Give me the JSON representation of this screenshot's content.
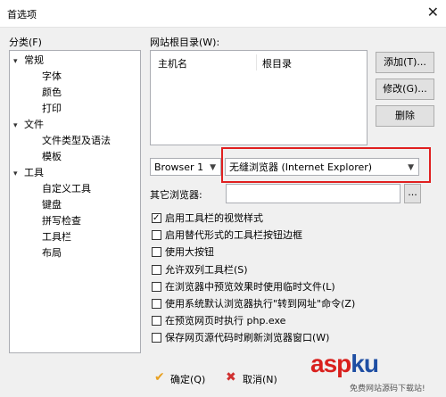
{
  "window": {
    "title": "首选项",
    "close_glyph": "✕"
  },
  "tree": {
    "label": "分类(F)",
    "nodes": [
      {
        "text": "常规",
        "level": 0,
        "expanded": true,
        "selected": false
      },
      {
        "text": "字体",
        "level": 1,
        "selected": false
      },
      {
        "text": "颜色",
        "level": 1,
        "selected": false
      },
      {
        "text": "打印",
        "level": 1,
        "selected": false
      },
      {
        "text": "文件",
        "level": 0,
        "expanded": true,
        "selected": false
      },
      {
        "text": "文件类型及语法",
        "level": 1,
        "selected": false
      },
      {
        "text": "模板",
        "level": 1,
        "selected": false
      },
      {
        "text": "工具",
        "level": 0,
        "expanded": true,
        "selected": true
      },
      {
        "text": "自定义工具",
        "level": 1,
        "selected": false
      },
      {
        "text": "键盘",
        "level": 1,
        "selected": false
      },
      {
        "text": "拼写检查",
        "level": 1,
        "selected": false
      },
      {
        "text": "工具栏",
        "level": 1,
        "selected": false
      },
      {
        "text": "布局",
        "level": 1,
        "selected": false
      }
    ]
  },
  "web_root": {
    "label": "网站根目录(W):",
    "columns": [
      "主机名",
      "根目录"
    ],
    "add": "添加(T)...",
    "edit": "修改(G)...",
    "delete": "删除"
  },
  "browser": {
    "slot_value": "Browser 1",
    "browser_value": "无缝浏览器 (Internet Explorer)",
    "other_label": "其它浏览器:",
    "browse_button": "..."
  },
  "options": [
    {
      "label": "启用工具栏的视觉样式",
      "checked": true
    },
    {
      "label": "启用替代形式的工具栏按钮边框",
      "checked": false
    },
    {
      "label": "使用大按钮",
      "checked": false
    },
    {
      "label": "允许双列工具栏(S)",
      "checked": false
    },
    {
      "label": "在浏览器中预览效果时使用临时文件(L)",
      "checked": false
    },
    {
      "label": "使用系统默认浏览器执行\"转到网址\"命令(Z)",
      "checked": false
    },
    {
      "label": "在预览网页时执行 php.exe",
      "checked": false
    },
    {
      "label": "保存网页源代码时刷新浏览器窗口(W)",
      "checked": false
    }
  ],
  "footer": {
    "ok": "确定(Q)",
    "cancel": "取消(N)"
  },
  "watermark": {
    "part1": "asp",
    "part2": "ku",
    "sub": "免费网站源码下载站!"
  },
  "colors": {
    "highlight_box": "#e02020",
    "ok_icon": "#e8a020",
    "cancel_icon": "#d03030"
  }
}
